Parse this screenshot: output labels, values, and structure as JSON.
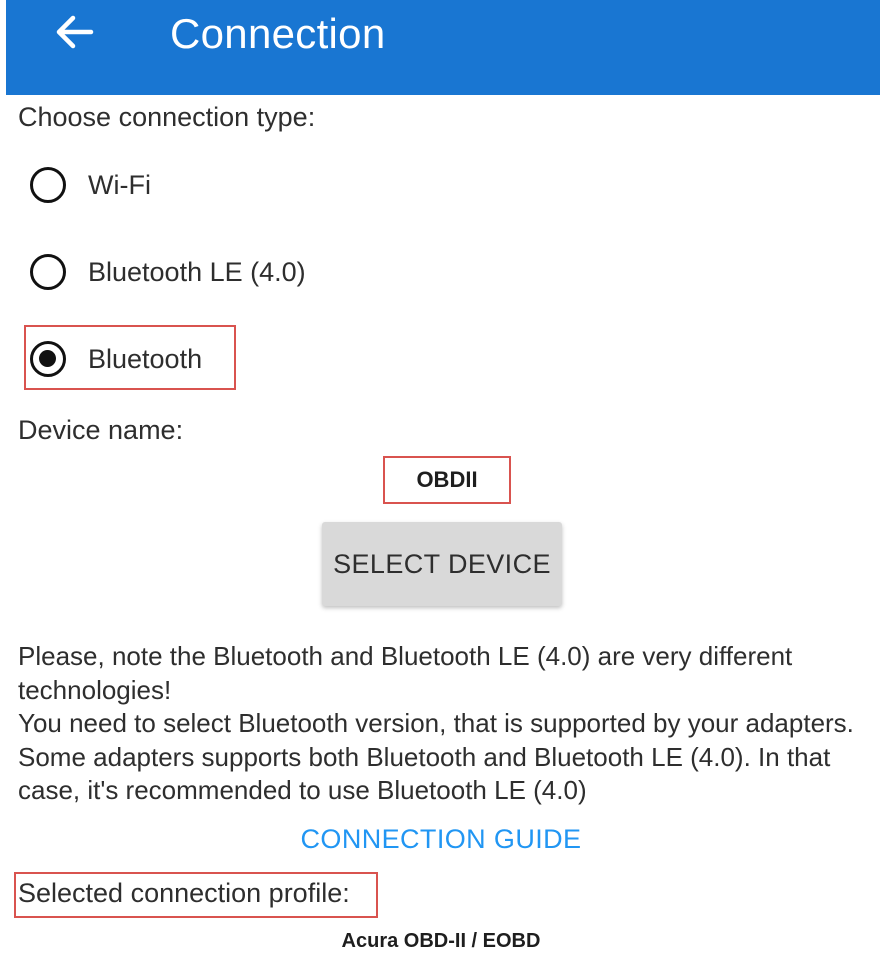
{
  "header": {
    "title": "Connection",
    "back_icon": "arrow-left-icon",
    "background": "#1976d2"
  },
  "connection": {
    "prompt": "Choose connection type:",
    "options": [
      {
        "label": "Wi-Fi",
        "selected": false
      },
      {
        "label": "Bluetooth LE (4.0)",
        "selected": false
      },
      {
        "label": "Bluetooth",
        "selected": true
      }
    ]
  },
  "device": {
    "label": "Device name:",
    "value": "OBDII",
    "select_button": "SELECT DEVICE"
  },
  "note": {
    "line1": "Please, note the Bluetooth and Bluetooth LE (4.0) are very different technologies!",
    "line2": "You need to select Bluetooth version, that is supported by your adapters. Some adapters supports both Bluetooth and Bluetooth LE (4.0). In that case, it's recommended to use Bluetooth LE (4.0)"
  },
  "guide": {
    "link_label": "CONNECTION GUIDE",
    "color": "#2196f3"
  },
  "profile": {
    "label": "Selected connection profile:",
    "value": "Acura OBD-II / EOBD"
  },
  "highlight_color": "#d9534f"
}
